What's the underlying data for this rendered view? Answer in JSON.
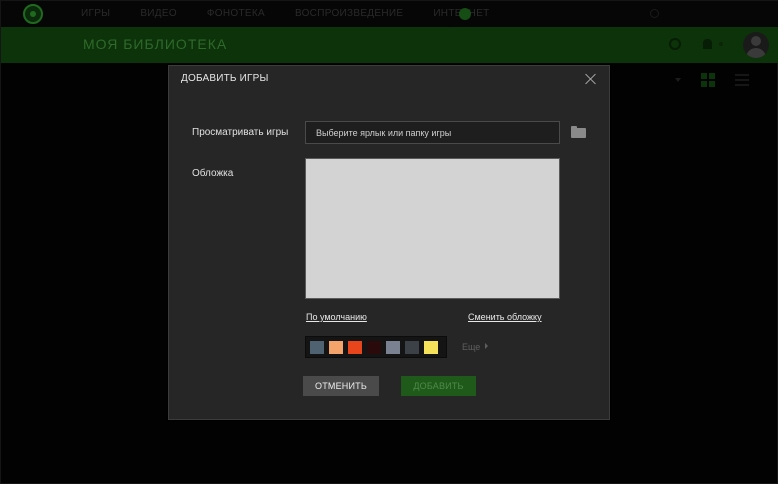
{
  "topbar": {
    "nav_items": [
      "ИГРЫ",
      "ВИДЕО",
      "ФОНОТЕКА",
      "ВОСПРОИЗВЕДЕНИЕ",
      "ИНТЕРНЕТ"
    ]
  },
  "library": {
    "title": "МОЯ БИБЛИОТЕКА"
  },
  "modal": {
    "title": "ДОБАВИТЬ ИГРЫ",
    "browse_label": "Просматривать игры",
    "path_placeholder": "Выберите ярлык или папку игры",
    "cover_label": "Обложка",
    "default_link": "По умолчанию",
    "change_cover_link": "Сменить обложку",
    "more_label": "Еще",
    "cancel_label": "ОТМЕНИТЬ",
    "add_label": "ДОБАВИТЬ",
    "swatches": [
      "#4f6272",
      "#f4a46a",
      "#e8451c",
      "#2a0a0a",
      "#7a8190",
      "#3c4047",
      "#f5e25a"
    ]
  },
  "colors": {
    "accent_green": "#1f5a1a",
    "background": "#020202",
    "modal_bg": "#262626",
    "cover_placeholder": "#d3d3d3"
  },
  "icons": {
    "close": "close-icon",
    "folder": "folder-icon",
    "search": "search-icon",
    "bell": "bell-icon",
    "grid_view": "grid-view-icon",
    "list_view": "list-view-icon"
  }
}
